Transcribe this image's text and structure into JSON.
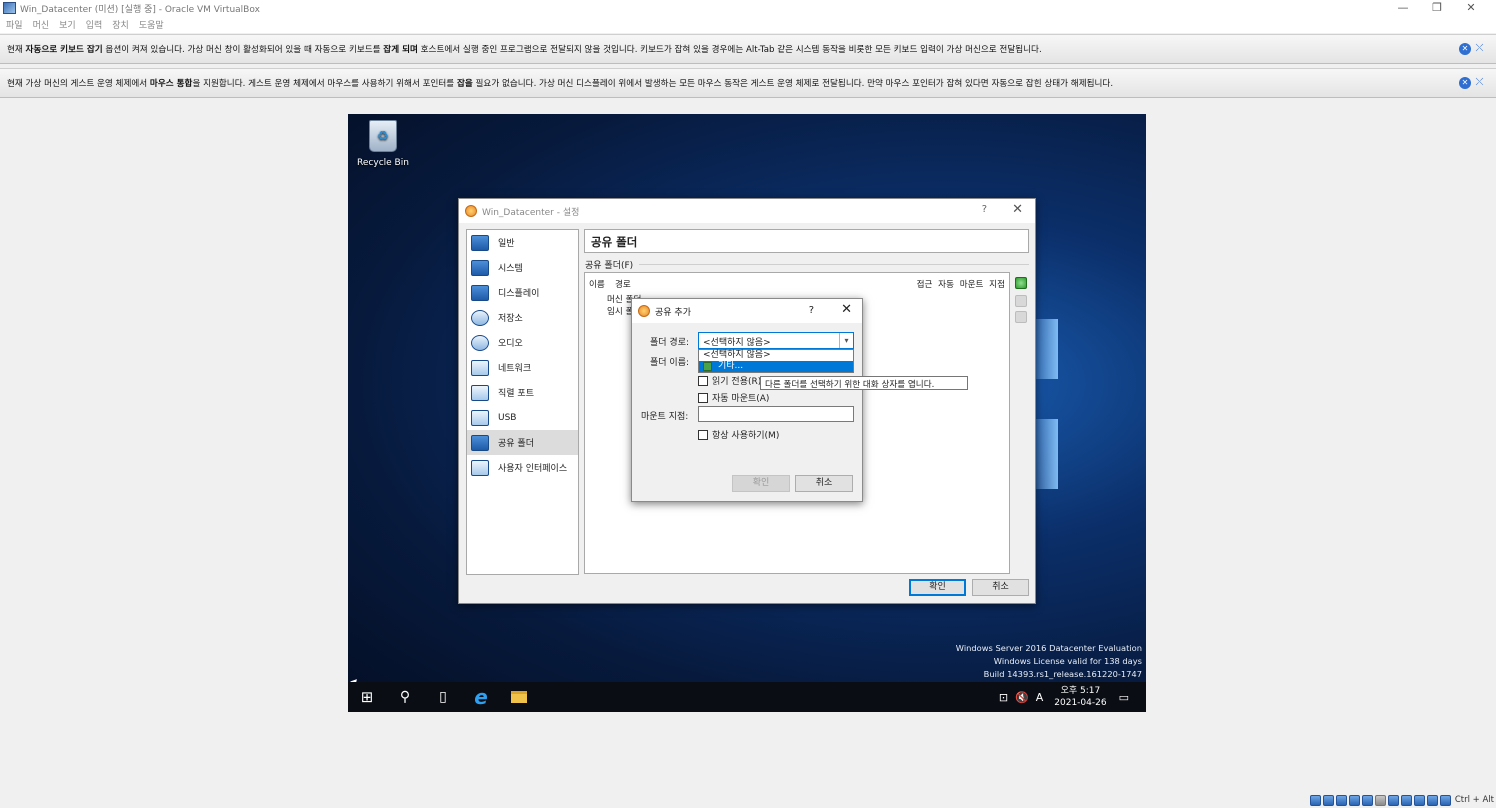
{
  "window": {
    "title": "Win_Datacenter (미션) [실행 중] - Oracle VM VirtualBox",
    "controls": [
      "—",
      "❐",
      "✕"
    ]
  },
  "menu": [
    "파일",
    "머신",
    "보기",
    "입력",
    "장치",
    "도움말"
  ],
  "notices": [
    {
      "pre": "현재 ",
      "b1": "자동으로 키보드 잡기",
      "mid": " 옵션이 켜져 있습니다. 가상 머신 창이 활성화되어 있을 때 자동으로 키보드를 ",
      "b2": "잡게 되며",
      "post": " 호스트에서 실행 중인 프로그램으로 전달되지 않을 것입니다. 키보드가 잡혀 있을 경우에는 Alt-Tab 같은 시스템 동작을 비롯한 모든 키보드 입력이 가상 머신으로 전달됩니다."
    },
    {
      "pre": "현재 가상 머신의 게스트 운영 체제에서 ",
      "b1": "마우스 통합",
      "mid": "을 지원합니다. 게스트 운영 체제에서 마우스를 사용하기 위해서 포인터를 ",
      "b2": "잡을",
      "post": " 필요가 없습니다. 가상 머신 디스플레이 위에서 발생하는 모든 마우스 동작은 게스트 운영 체제로 전달됩니다. 만약 마우스 포인터가 잡혀 있다면 자동으로 잡힌 상태가 해제됩니다."
    }
  ],
  "desktop": {
    "recycle_bin": "Recycle Bin",
    "watermark": [
      "Windows Server 2016 Datacenter Evaluation",
      "Windows License valid for 138 days",
      "Build 14393.rs1_release.161220-1747"
    ],
    "clock_time": "오후 5:17",
    "clock_date": "2021-04-26",
    "ime": "A"
  },
  "settings": {
    "title": "Win_Datacenter - 설정",
    "help": "?",
    "close": "✕",
    "categories": [
      "일반",
      "시스템",
      "디스플레이",
      "저장소",
      "오디오",
      "네트워크",
      "직렬 포트",
      "USB",
      "공유 폴더",
      "사용자 인터페이스"
    ],
    "selected_category": "공유 폴더",
    "page_title": "공유 폴더",
    "group_label": "공유 폴더(F)",
    "columns": {
      "name": "이름",
      "path": "경로",
      "right": "접근 자동 마운트 지점"
    },
    "rows": [
      "머신 폴더",
      "임시 폴더"
    ],
    "ok": "확인",
    "cancel": "취소"
  },
  "add_share": {
    "title": "공유 추가",
    "help": "?",
    "close": "✕",
    "folder_path_label": "폴더 경로:",
    "folder_path_value": "<선택하지 않음>",
    "dropdown_options": [
      "<선택하지 않음>",
      "기타..."
    ],
    "folder_name_label": "폴더 이름:",
    "readonly_label": "읽기 전용(R)",
    "automount_label": "자동 마운트(A)",
    "mountpoint_label": "마운트 지점:",
    "always_label": "항상 사용하기(M)",
    "ok": "확인",
    "cancel": "취소",
    "tooltip": "다른 폴더를 선택하기 위한 대화 상자를 엽니다."
  },
  "statusbar": {
    "host_key": "Ctrl + Alt"
  },
  "colors": {
    "accent": "#0078d7",
    "desktop": "#0b2f6a",
    "taskbar": "#0a0d14"
  }
}
